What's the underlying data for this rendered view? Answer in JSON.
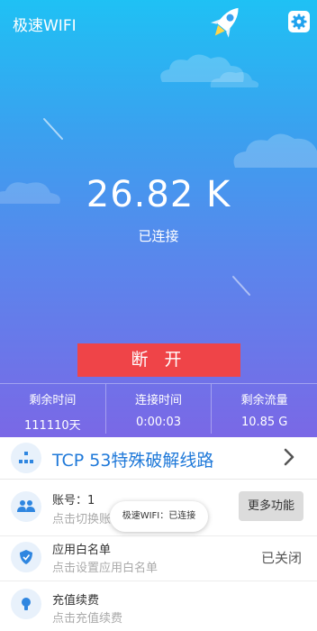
{
  "app": {
    "title": "极速WIFI"
  },
  "connection": {
    "speed": "26.82 K",
    "status": "已连接",
    "disconnect_label": "断 开"
  },
  "stats": [
    {
      "label": "剩余时间",
      "value": "111110天"
    },
    {
      "label": "连接时间",
      "value": "0:00:03"
    },
    {
      "label": "剩余流量",
      "value": "10.85 G"
    }
  ],
  "route": {
    "title": "TCP 53特殊破解线路"
  },
  "account": {
    "title": "账号：1",
    "subtitle": "点击切换账"
  },
  "whitelist": {
    "title": "应用白名单",
    "subtitle": "点击设置应用白名单",
    "state": "已关闭"
  },
  "recharge": {
    "title": "充值续费",
    "subtitle": "点击充值续费"
  },
  "buttons": {
    "more": "更多功能"
  },
  "toast": {
    "text": "极速WIFI：已连接"
  },
  "colors": {
    "accent": "#1f79d9",
    "disconnect": "#ef4448"
  }
}
